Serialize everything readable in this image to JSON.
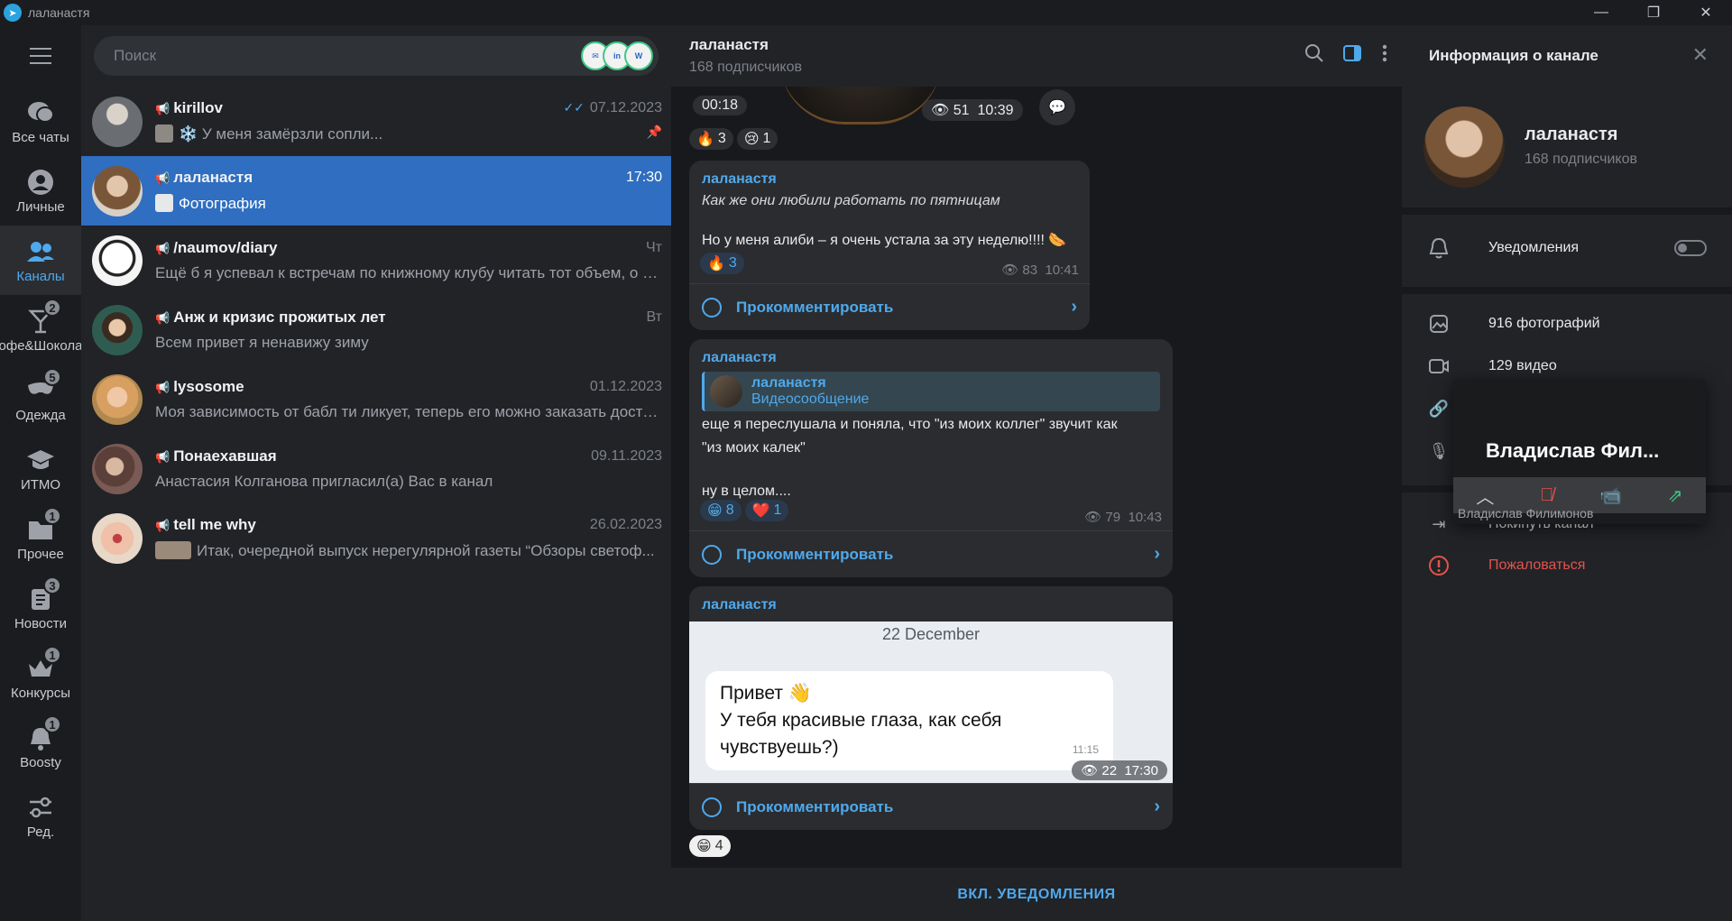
{
  "window": {
    "title": "лаланастя"
  },
  "folders": [
    {
      "label": "Все чаты",
      "icon": "chats-icon",
      "badge": ""
    },
    {
      "label": "Личные",
      "icon": "person-icon",
      "badge": ""
    },
    {
      "label": "Каналы",
      "icon": "channels-icon",
      "badge": "",
      "active": true
    },
    {
      "label": "Кофе&Шоколад",
      "icon": "cocktail-icon",
      "badge": "2"
    },
    {
      "label": "Одежда",
      "icon": "mask-icon",
      "badge": "5"
    },
    {
      "label": "ИТМО",
      "icon": "graduation-icon",
      "badge": ""
    },
    {
      "label": "Прочее",
      "icon": "folder-icon",
      "badge": "1"
    },
    {
      "label": "Новости",
      "icon": "news-icon",
      "badge": "3"
    },
    {
      "label": "Конкурсы",
      "icon": "crown-icon",
      "badge": "1"
    },
    {
      "label": "Boosty",
      "icon": "bell-icon",
      "badge": "1"
    },
    {
      "label": "Ред.",
      "icon": "sliders-icon",
      "badge": ""
    }
  ],
  "search": {
    "placeholder": "Поиск"
  },
  "chats": [
    {
      "name": "kirillov",
      "time": "07.12.2023",
      "preview": "У меня замёрзли сопли...",
      "avatar_color": "#8a8e94"
    },
    {
      "name": "лаланастя",
      "time": "17:30",
      "preview": "Фотография",
      "avatar_color": "#b08a6a",
      "active": true
    },
    {
      "name": "/naumov/diary",
      "time": "Чт",
      "preview": "Ещё б я успевал к встречам по книжному клубу читать тот объем, о к...",
      "avatar_color": "#f0f0f0"
    },
    {
      "name": "Анж и кризис прожитых лет",
      "time": "Вт",
      "preview": "Всем привет я ненавижу зиму",
      "avatar_color": "#2f5c50"
    },
    {
      "name": "lysosome",
      "time": "01.12.2023",
      "preview": "Моя зависимость от бабл ти ликует, теперь его можно заказать доста...",
      "avatar_color": "#c9a27a"
    },
    {
      "name": "Понаехавшая",
      "time": "09.11.2023",
      "preview": "Анастасия Колганова пригласил(а) Вас в канал",
      "avatar_color": "#7a5a55"
    },
    {
      "name": "tell me why",
      "time": "26.02.2023",
      "preview": "Итак, очередной выпуск нерегулярной газеты “Обзоры светоф...",
      "avatar_color": "#d8a090"
    }
  ],
  "header": {
    "title": "лаланастя",
    "subtitle": "168 подписчиков"
  },
  "messages": {
    "video": {
      "duration": "00:18",
      "views": "51",
      "time": "10:39"
    },
    "video_reactions": [
      {
        "emoji": "🔥",
        "count": "3"
      },
      {
        "emoji": "😢",
        "count": "1"
      }
    ],
    "msg1": {
      "from": "лаланастя",
      "line1": "Как же они любили работать по пятницам",
      "line2": "Но у меня алиби – я очень устала за эту неделю!!!! 🌭",
      "reaction_emoji": "🔥",
      "reaction_count": "3",
      "views": "83",
      "time": "10:41",
      "comment": "Прокомментировать"
    },
    "msg2": {
      "from": "лаланастя",
      "fwd_name": "лаланастя",
      "fwd_type": "Видеосообщение",
      "line1": "еще я переслушала и поняла, что \"из моих коллег\" звучит как",
      "line2": "\"из моих калек\"",
      "line3": "ну в целом....",
      "r1_emoji": "😁",
      "r1_count": "8",
      "r2_emoji": "❤️",
      "r2_count": "1",
      "views": "79",
      "time": "10:43",
      "comment": "Прокомментировать"
    },
    "msg3": {
      "from": "лаланастя",
      "photo_date": "22 December",
      "photo_line1": "Привет 👋",
      "photo_line2": "У тебя красивые глаза, как себя",
      "photo_line3": "чувствуешь?)",
      "photo_ts": "11:15",
      "views": "22",
      "time": "17:30",
      "comment": "Прокомментировать"
    },
    "last_reaction": {
      "emoji": "😁",
      "count": "4"
    }
  },
  "bottom": {
    "label": "ВКЛ. УВЕДОМЛЕНИЯ"
  },
  "panel": {
    "title": "Информация о канале",
    "name": "лаланастя",
    "subtitle": "168 подписчиков",
    "notifications": "Уведомления",
    "photos": "916 фотографий",
    "videos": "129 видео",
    "leave": "Покинуть канал",
    "report": "Пожаловаться"
  },
  "call": {
    "name": "Владислав  Фил...",
    "caption": "Владислав Филимонов"
  }
}
